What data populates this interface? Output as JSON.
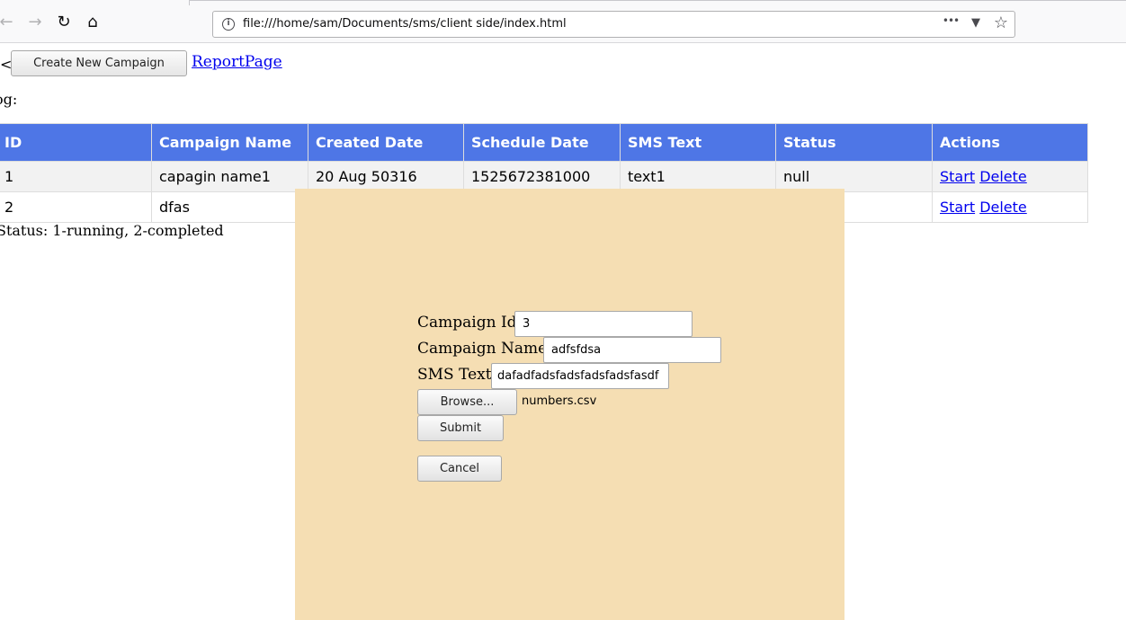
{
  "browser": {
    "url": "file:///home/sam/Documents/sms/client side/index.html",
    "back_icon": "←",
    "forward_icon": "→",
    "reload_icon": "↻",
    "home_icon": "⌂",
    "info_icon": "i",
    "menu_icon": "•••",
    "pocket_icon": "▼",
    "bookmark_icon": "☆"
  },
  "header": {
    "left_char": "<",
    "create_button": "Create New Campaign",
    "report_link": "ReportPage",
    "log_label": "og:"
  },
  "table": {
    "columns": [
      "ID",
      "Campaign Name",
      "Created Date",
      "Schedule Date",
      "SMS Text",
      "Status",
      "Actions"
    ],
    "rows": [
      {
        "id": "1",
        "name": "capagin name1",
        "created": "20 Aug 50316",
        "schedule": "1525672381000",
        "text": "text1",
        "status": "null",
        "start": "Start",
        "delete": "Delete"
      },
      {
        "id": "2",
        "name": "dfas",
        "created": "",
        "schedule": "",
        "text": "",
        "status": "",
        "start": "Start",
        "delete": "Delete"
      }
    ],
    "note": "Status: 1-running, 2-completed"
  },
  "modal": {
    "campaign_id_label": "Campaign Id",
    "campaign_id_value": "3",
    "campaign_name_label": "Campaign Name",
    "campaign_name_value": "adfsfdsa",
    "sms_text_label": "SMS Text",
    "sms_text_value": "dafadfadsfadsfadsfadsfasdf",
    "browse_button": "Browse...",
    "file_name": "numbers.csv",
    "submit_button": "Submit",
    "cancel_button": "Cancel"
  }
}
